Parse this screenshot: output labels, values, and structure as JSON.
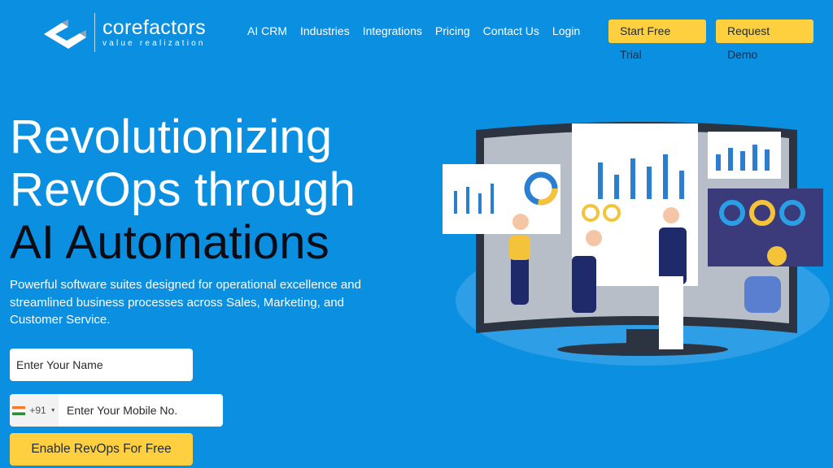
{
  "brand": {
    "name": "corefactors",
    "tagline": "value realization"
  },
  "nav": {
    "items": [
      "AI CRM",
      "Industries",
      "Integrations",
      "Pricing",
      "Contact Us",
      "Login"
    ],
    "start_trial": "Start Free Trial",
    "request_demo": "Request Demo"
  },
  "hero": {
    "title_line1": "Revolutionizing",
    "title_line2": "RevOps through",
    "title_line3": "AI Automations",
    "subtitle": "Powerful software suites designed for operational excellence and streamlined business processes across Sales, Marketing, and Customer Service."
  },
  "form": {
    "name_placeholder": "Enter Your Name",
    "country_code": "+91",
    "mobile_placeholder": "Enter Your Mobile No.",
    "submit": "Enable RevOps For Free"
  },
  "colors": {
    "background": "#0b8fe0",
    "accent": "#fed03f"
  }
}
